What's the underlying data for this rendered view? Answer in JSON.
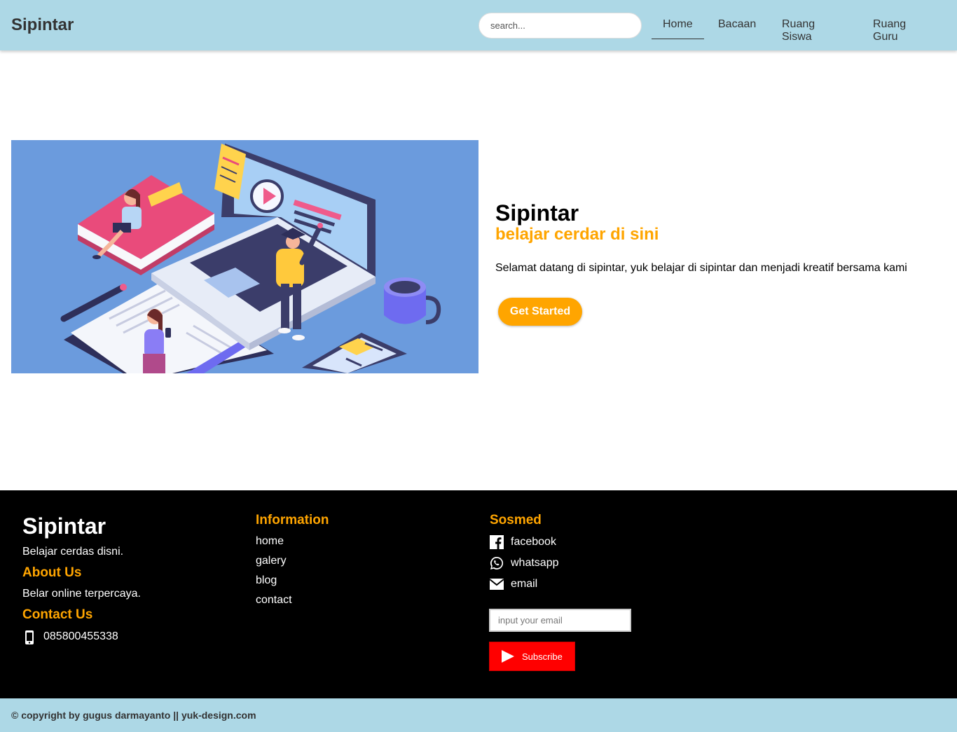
{
  "header": {
    "brand": "Sipintar",
    "search_placeholder": "search...",
    "nav": [
      {
        "label": "Home"
      },
      {
        "label": "Bacaan"
      },
      {
        "label": "Ruang Siswa"
      },
      {
        "label": "Ruang Guru"
      }
    ],
    "active_nav": "Home"
  },
  "hero": {
    "title": "Sipintar",
    "subtitle": "belajar cerdar di sini",
    "description": "Selamat datang di sipintar, yuk belajar di sipintar dan menjadi kreatif bersama kami",
    "cta_label": "Get Started"
  },
  "footer": {
    "brand": "Sipintar",
    "tagline": "Belajar cerdas disni.",
    "about_heading": "About Us",
    "about_text": "Belar online terpercaya.",
    "contact_heading": "Contact Us",
    "phone": "085800455338",
    "info_heading": "Information",
    "info_links": [
      {
        "label": "home"
      },
      {
        "label": "galery"
      },
      {
        "label": "blog"
      },
      {
        "label": "contact"
      }
    ],
    "sosmed_heading": "Sosmed",
    "sosmed": [
      {
        "label": "facebook",
        "icon": "facebook-icon"
      },
      {
        "label": "whatsapp",
        "icon": "whatsapp-icon"
      },
      {
        "label": "email",
        "icon": "mail-icon"
      }
    ],
    "email_placeholder": "input your email",
    "subscribe_label": "Subscribe"
  },
  "copyright": "© copyright by gugus darmayanto || yuk-design.com",
  "colors": {
    "header_bg": "#add8e6",
    "accent": "#ffa500",
    "footer_bg": "#000000",
    "subscribe_bg": "#ff0000"
  }
}
